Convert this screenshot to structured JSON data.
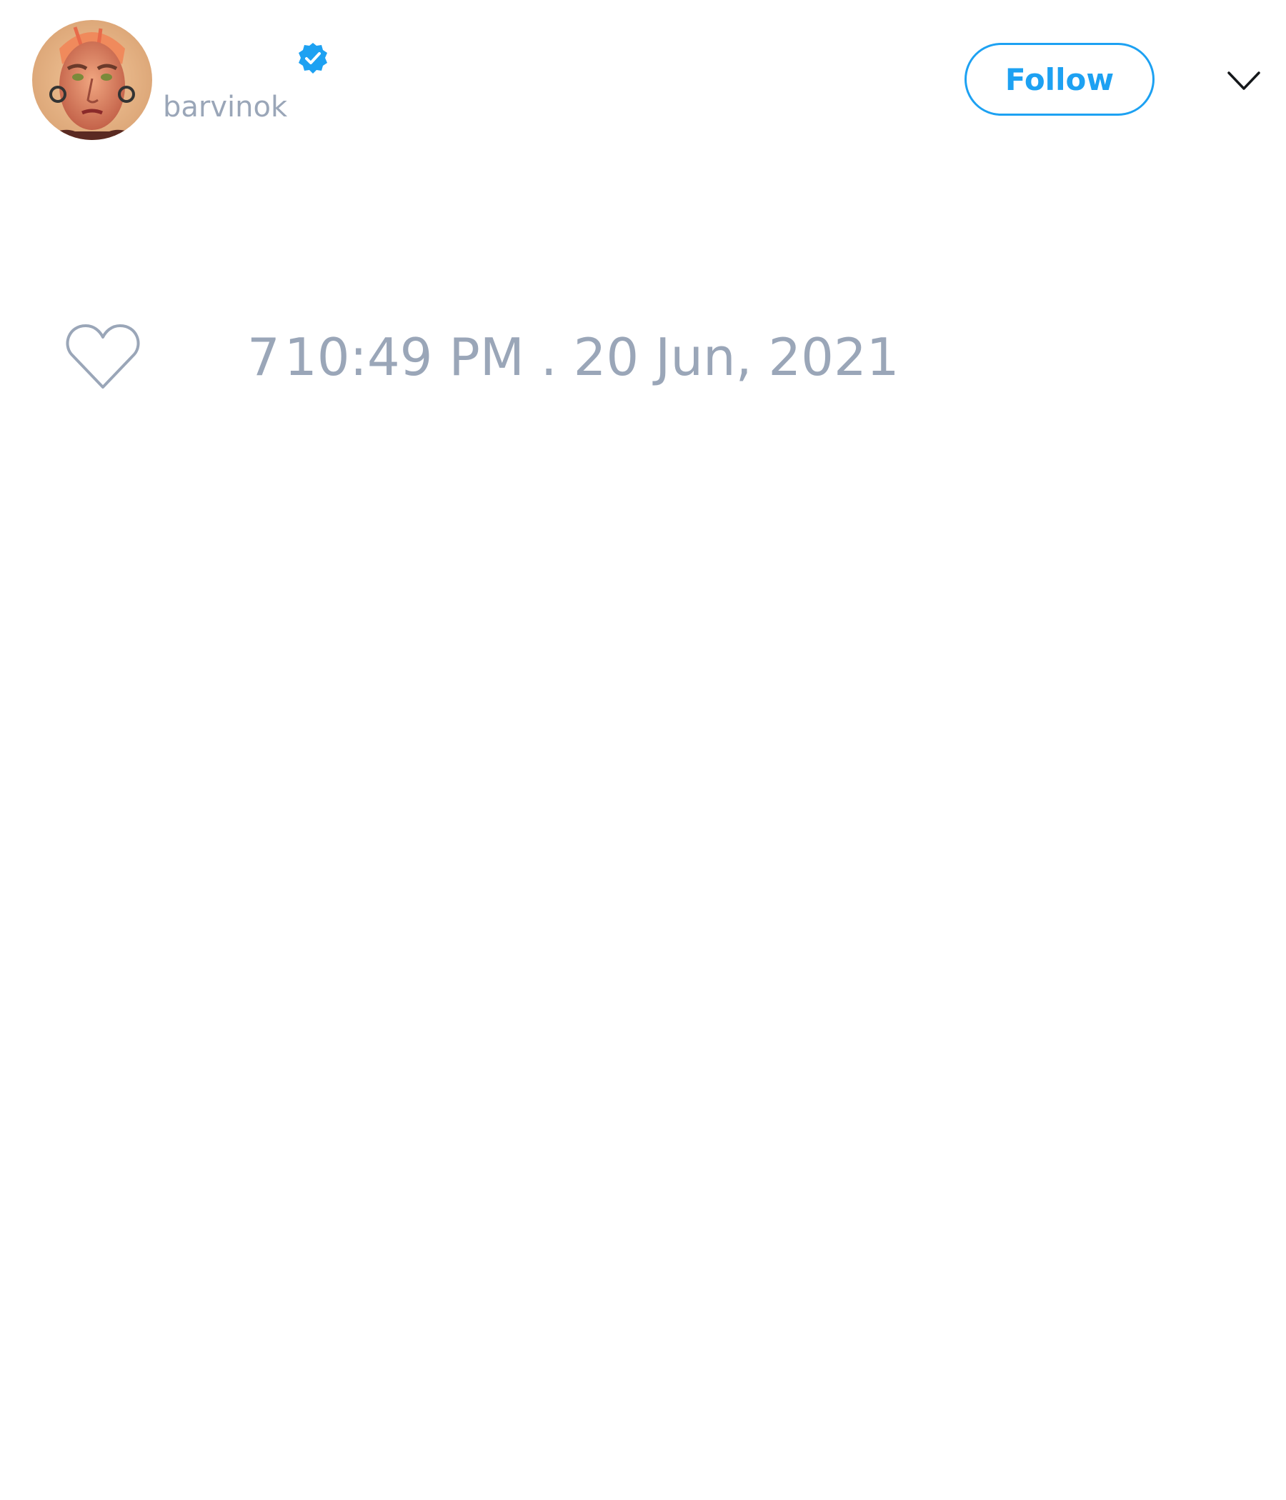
{
  "tweet": {
    "author": {
      "display_name": "",
      "handle": "barvinok",
      "verified": true,
      "avatar_icon": "profile-photo"
    },
    "follow_label": "Follow",
    "menu_icon": "chevron-down-icon",
    "like_count": "7",
    "timestamp": "10:49 PM . 20 Jun, 2021"
  },
  "colors": {
    "accent": "#1da1f2",
    "muted_text": "#9aa6b8",
    "background": "#ffffff"
  }
}
